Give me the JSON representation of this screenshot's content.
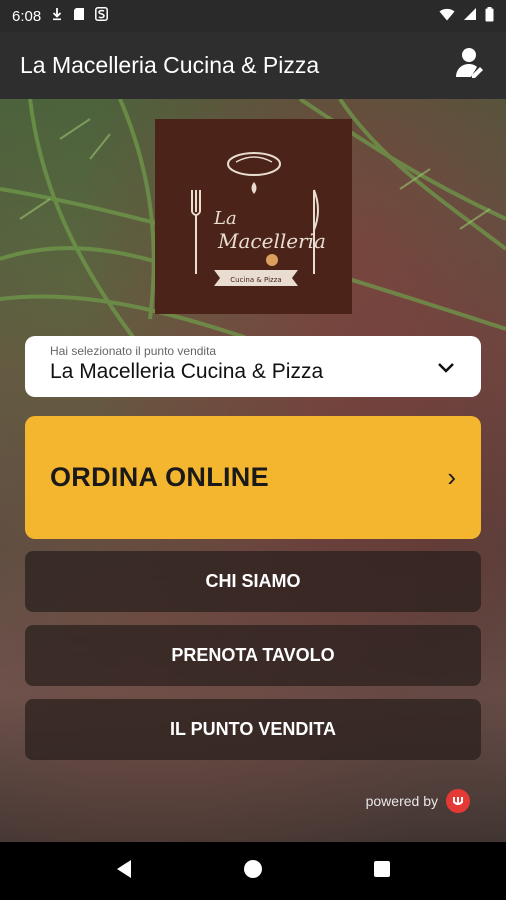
{
  "status_bar": {
    "time": "6:08"
  },
  "app_bar": {
    "title": "La Macelleria Cucina & Pizza"
  },
  "logo": {
    "line1": "La",
    "line2": "Macelleria",
    "line3": "Cucina & Pizza"
  },
  "store_selector": {
    "label": "Hai selezionato il punto vendita",
    "value": "La Macelleria Cucina & Pizza"
  },
  "order_button": {
    "label": "ORDINA ONLINE",
    "arrow": "›"
  },
  "menu": {
    "chi_siamo": "CHI SIAMO",
    "prenota_tavolo": "PRENOTA TAVOLO",
    "punto_vendita": "IL PUNTO VENDITA"
  },
  "footer": {
    "powered_by": "powered by"
  },
  "colors": {
    "accent": "#f4b52f",
    "logo_bg": "#4b2319",
    "brand_red": "#e53935"
  },
  "icons": [
    "download-icon",
    "sd-card-icon",
    "s-icon",
    "wifi-icon",
    "signal-icon",
    "battery-icon",
    "account-icon",
    "chevron-down-icon",
    "back-icon",
    "home-icon",
    "recents-icon"
  ]
}
